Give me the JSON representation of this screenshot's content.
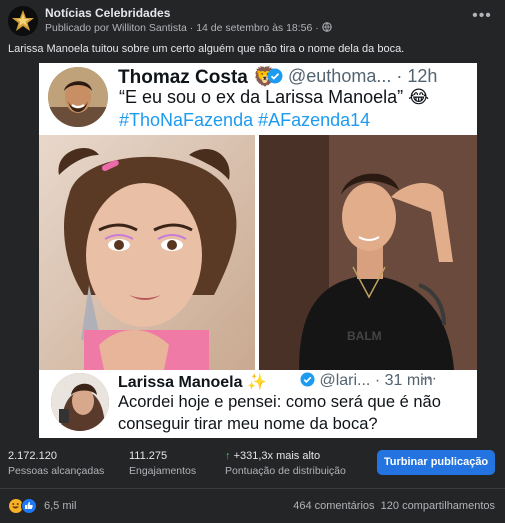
{
  "post": {
    "page_name": "Notícias Celebridades",
    "meta_prefix": "Publicado por",
    "author": "Williton Santista",
    "date": "14 de setembro às 18:56",
    "separator": "·",
    "caption": "Larissa Manoela tuitou sobre um certo alguém que não tira o nome dela da boca."
  },
  "tweet1": {
    "name": "Thomaz Costa",
    "emoji": "🦁",
    "handle": "@euthoma...",
    "time": "· 12h",
    "text": "“E eu sou o ex da Larissa Manoela” 😂",
    "hashtags": "#ThoNaFazenda #AFazenda14"
  },
  "tweet2": {
    "name": "Larissa Manoela",
    "sparkle": "✨",
    "handle": "@lari...",
    "time": "· 31 min",
    "more": "···",
    "text": "Acordei hoje e pensei: como será que é não conseguir tirar meu nome da boca?"
  },
  "insights": {
    "reach_value": "2.172.120",
    "reach_label": "Pessoas alcançadas",
    "engagement_value": "111.275",
    "engagement_label": "Engajamentos",
    "distribution_arrow": "↑",
    "distribution_value": "+331,3x mais alto",
    "distribution_label": "Pontuação de distribuição",
    "boost_label": "Turbinar publicação"
  },
  "footer": {
    "reaction_count": "6,5 mil",
    "comments": "464 comentários",
    "shares": "120 compartilhamentos"
  },
  "colors": {
    "background": "#242526",
    "accent": "#2374e1",
    "link_blue": "#1d9bf0",
    "positive": "#45bd62"
  },
  "icons": [
    "page-avatar-star-icon",
    "globe-icon",
    "more-icon",
    "lion-emoji-icon",
    "verified-icon",
    "sparkle-icon",
    "haha-reaction-icon",
    "like-reaction-icon"
  ]
}
